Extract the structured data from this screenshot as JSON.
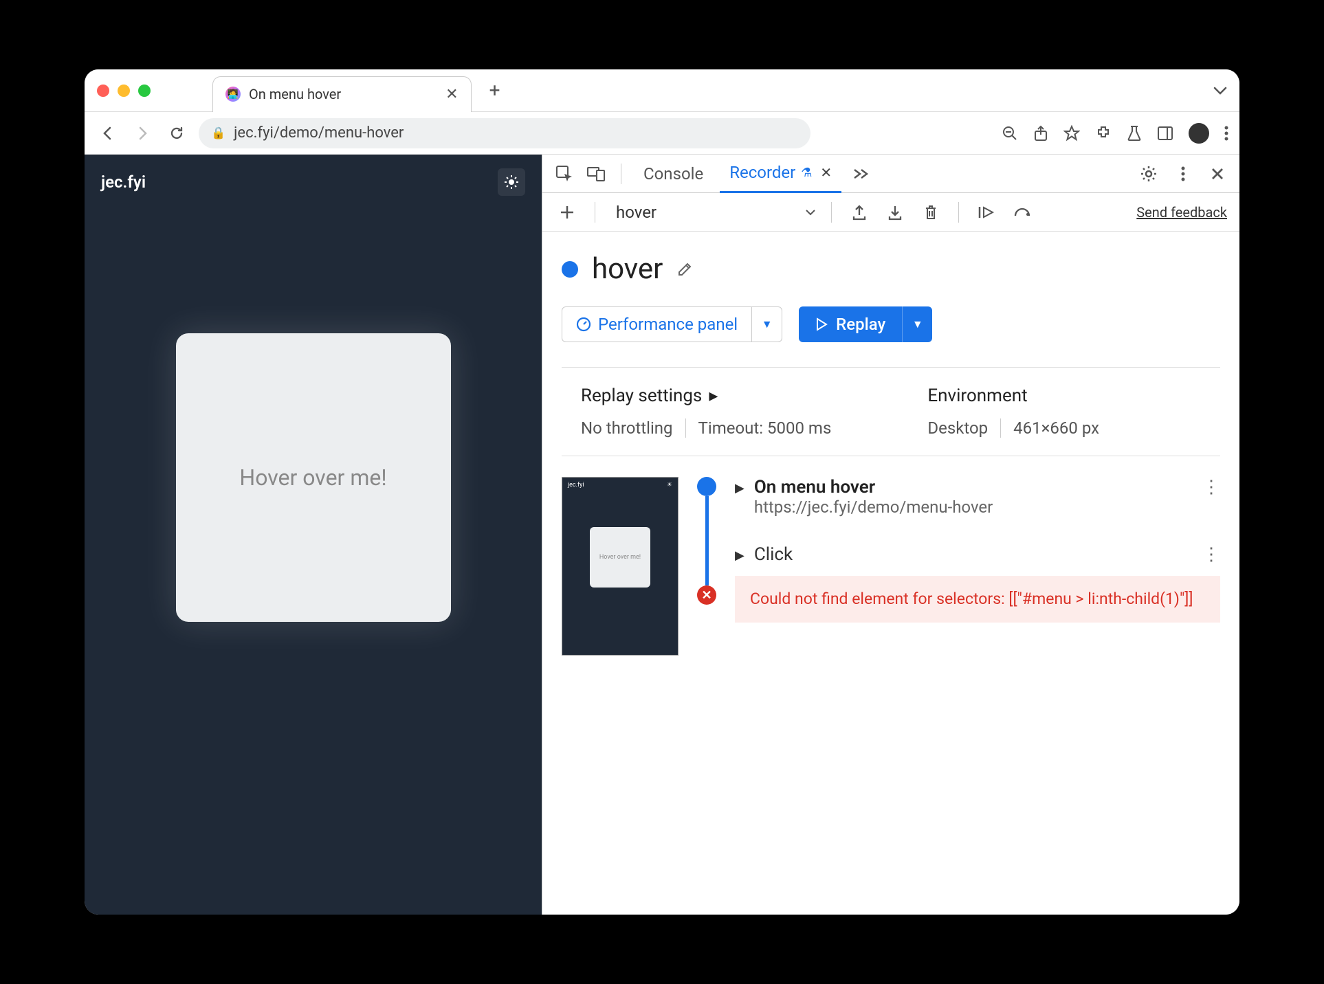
{
  "browser": {
    "tab_title": "On menu hover",
    "url_display": "jec.fyi/demo/menu-hover"
  },
  "page": {
    "brand": "jec.fyi",
    "box_text": "Hover over me!"
  },
  "devtools": {
    "tabs": {
      "console": "Console",
      "recorder": "Recorder"
    },
    "toolbar": {
      "recording_name": "hover",
      "feedback": "Send feedback"
    },
    "recording": {
      "title": "hover",
      "perf_panel": "Performance panel",
      "replay": "Replay",
      "settings": {
        "replay_heading": "Replay settings",
        "throttling": "No throttling",
        "timeout": "Timeout: 5000 ms",
        "env_heading": "Environment",
        "device": "Desktop",
        "viewport": "461×660 px"
      },
      "thumb_text": "Hover over me!",
      "steps": {
        "s1_title": "On menu hover",
        "s1_url": "https://jec.fyi/demo/menu-hover",
        "s2_title": "Click",
        "error": "Could not find element for selectors: [[\"#menu > li:nth-child(1)\"]]"
      }
    }
  }
}
